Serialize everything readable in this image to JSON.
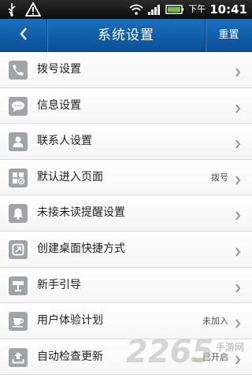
{
  "status_bar": {
    "carrier": "下午",
    "time": "10:41"
  },
  "header": {
    "title": "系统设置",
    "reset_label": "重置"
  },
  "settings": {
    "items": [
      {
        "label": "拨号设置",
        "value": "",
        "icon": "phone-icon"
      },
      {
        "label": "信息设置",
        "value": "",
        "icon": "message-icon"
      },
      {
        "label": "联系人设置",
        "value": "",
        "icon": "contact-icon"
      },
      {
        "label": "默认进入页面",
        "value": "拨号",
        "icon": "default-page-icon"
      },
      {
        "label": "未接未读提醒设置",
        "value": "",
        "icon": "bell-icon"
      },
      {
        "label": "创建桌面快捷方式",
        "value": "",
        "icon": "shortcut-icon"
      },
      {
        "label": "新手引导",
        "value": "",
        "icon": "guide-icon"
      },
      {
        "label": "用户体验计划",
        "value": "未加入",
        "icon": "cup-icon"
      },
      {
        "label": "自动检查更新",
        "value": "已开启",
        "icon": "upload-icon"
      }
    ]
  },
  "watermark": {
    "brand": "2265",
    "site": "手游网",
    "url": ".com"
  },
  "colors": {
    "title_bar": "#0f5fae",
    "status_bar": "#1a1a1a",
    "icon_gray": "#9fa4a9"
  }
}
